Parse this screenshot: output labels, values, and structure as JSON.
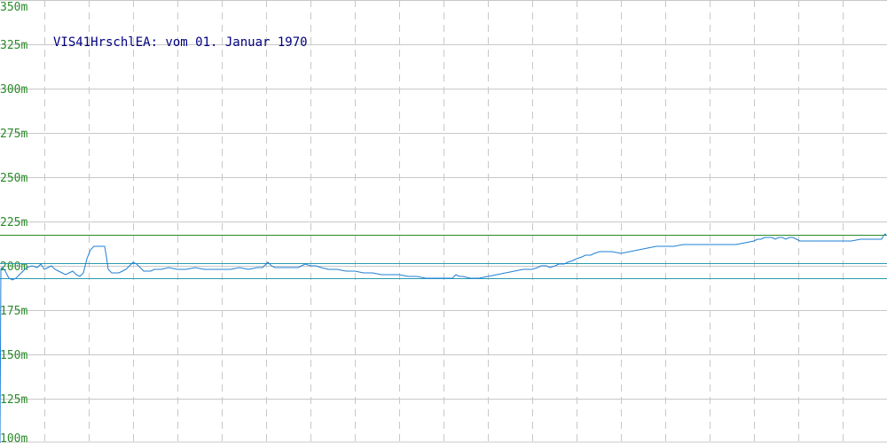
{
  "chart_data": {
    "type": "line",
    "title": "VIS41HrschlEA: vom 01. Januar 1970",
    "xlabel": "",
    "ylabel": "",
    "ylim": [
      100,
      350
    ],
    "y_ticks": [
      {
        "value": 350,
        "label": "350m"
      },
      {
        "value": 325,
        "label": "325m"
      },
      {
        "value": 300,
        "label": "300m"
      },
      {
        "value": 275,
        "label": "275m"
      },
      {
        "value": 250,
        "label": "250m"
      },
      {
        "value": 225,
        "label": "225m"
      },
      {
        "value": 200,
        "label": "200m"
      },
      {
        "value": 175,
        "label": "175m"
      },
      {
        "value": 150,
        "label": "150m"
      },
      {
        "value": 125,
        "label": "125m"
      },
      {
        "value": 100,
        "label": "100m"
      }
    ],
    "grid": true,
    "vertical_gridlines": 20,
    "reference_lines": [
      {
        "value": 217.5,
        "color": "#2a8a2a"
      },
      {
        "value": 201.5,
        "color": "#2a9ab0"
      },
      {
        "value": 193,
        "color": "#2a9ab0"
      }
    ],
    "series": [
      {
        "name": "",
        "color": "#1e7fd6",
        "x": [
          0,
          1,
          2,
          3,
          6,
          10,
          14,
          18,
          22,
          26,
          30,
          36,
          42,
          46,
          50,
          54,
          58,
          62,
          66,
          70,
          74,
          78,
          82,
          86,
          90,
          94,
          98,
          102,
          106,
          110,
          114,
          118,
          120,
          122,
          126,
          130,
          134,
          138,
          142,
          146,
          150,
          154,
          158,
          162,
          166,
          170,
          174,
          178,
          182,
          190,
          200,
          210,
          220,
          230,
          240,
          250,
          260,
          270,
          280,
          290,
          296,
          302,
          306,
          310,
          314,
          318,
          324,
          330,
          336,
          340,
          344,
          350,
          356,
          362,
          370,
          380,
          390,
          400,
          410,
          420,
          430,
          440,
          450,
          460,
          470,
          480,
          490,
          500,
          510,
          514,
          518,
          522,
          530,
          540,
          550,
          560,
          570,
          580,
          590,
          600,
          606,
          610,
          616,
          620,
          626,
          630,
          636,
          640,
          646,
          650,
          656,
          660,
          666,
          670,
          676,
          680,
          690,
          700,
          710,
          720,
          730,
          740,
          750,
          760,
          770,
          780,
          790,
          800,
          810,
          820,
          830,
          840,
          850,
          854,
          858,
          862,
          866,
          870,
          874,
          878,
          882,
          886,
          890,
          894,
          898,
          902,
          906,
          910,
          916,
          920,
          930,
          940,
          950,
          960,
          970,
          980,
          986,
          990,
          994,
          996,
          998,
          999
        ],
        "values": [
          100,
          198,
          199,
          199,
          197,
          193,
          192,
          193,
          195,
          197,
          199,
          200,
          199,
          201,
          198,
          199,
          200,
          198,
          197,
          196,
          195,
          196,
          197,
          195,
          194,
          196,
          204,
          209,
          211,
          211,
          211,
          211,
          205,
          198,
          196,
          196,
          196,
          197,
          198,
          200,
          202,
          201,
          199,
          197,
          197,
          197,
          198,
          198,
          198,
          199,
          198,
          198,
          199,
          198,
          198,
          198,
          198,
          199,
          198,
          199,
          199,
          202,
          200,
          199,
          199,
          199,
          199,
          199,
          199,
          200,
          201,
          200,
          200,
          199,
          198,
          198,
          197,
          197,
          196,
          196,
          195,
          195,
          195,
          194,
          194,
          193,
          193,
          193,
          193,
          195,
          194,
          194,
          193,
          193,
          194,
          195,
          196,
          197,
          198,
          198,
          199,
          200,
          200,
          199,
          200,
          201,
          201,
          202,
          203,
          204,
          205,
          206,
          206,
          207,
          208,
          208,
          208,
          207,
          208,
          209,
          210,
          211,
          211,
          211,
          212,
          212,
          212,
          212,
          212,
          212,
          212,
          213,
          214,
          215,
          215,
          216,
          216,
          216,
          215,
          216,
          216,
          215,
          216,
          216,
          215,
          214,
          214,
          214,
          214,
          214,
          214,
          214,
          214,
          214,
          215,
          215,
          215,
          215,
          215,
          217,
          218,
          217
        ]
      }
    ]
  }
}
